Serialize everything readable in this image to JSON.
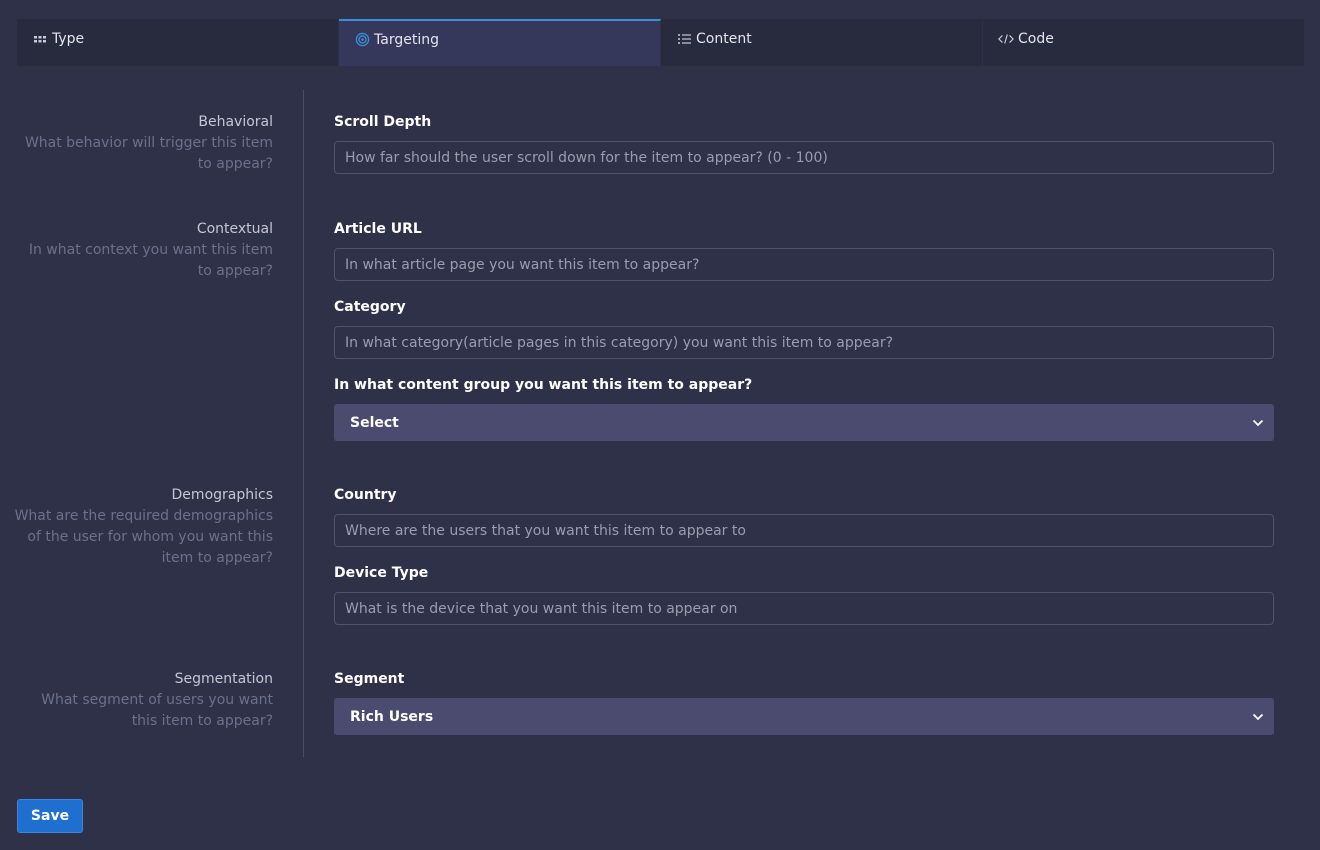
{
  "tabs": [
    {
      "label": "Type",
      "icon": "grid-dots-icon"
    },
    {
      "label": "Targeting",
      "icon": "target-icon"
    },
    {
      "label": "Content",
      "icon": "list-icon"
    },
    {
      "label": "Code",
      "icon": "code-icon"
    }
  ],
  "active_tab": "Targeting",
  "colors": {
    "background": "#2f3149",
    "accent": "#3a8fd6",
    "select_bg": "#4a4b6f",
    "save_button": "#1f6fd1"
  },
  "sections": {
    "behavioral": {
      "title": "Behavioral",
      "description": "What behavior will trigger this item to appear?"
    },
    "contextual": {
      "title": "Contextual",
      "description": "In what context you want this item to appear?"
    },
    "demographics": {
      "title": "Demographics",
      "description": "What are the required demographics of the user for whom you want this item to appear?"
    },
    "segmentation": {
      "title": "Segmentation",
      "description": "What segment of users you want this item to appear?"
    }
  },
  "fields": {
    "scroll_depth": {
      "label": "Scroll Depth",
      "value": "",
      "placeholder": "How far should the user scroll down for the item to appear? (0 - 100)"
    },
    "article_url": {
      "label": "Article URL",
      "value": "",
      "placeholder": "In what article page you want this item to appear?"
    },
    "category": {
      "label": "Category",
      "value": "",
      "placeholder": "In what category(article pages in this category) you want this item to appear?"
    },
    "content_group": {
      "label": "In what content group you want this item to appear?",
      "selected": "Select"
    },
    "country": {
      "label": "Country",
      "value": "",
      "placeholder": "Where are the users that you want this item to appear to"
    },
    "device_type": {
      "label": "Device Type",
      "value": "",
      "placeholder": "What is the device that you want this item to appear on"
    },
    "segment": {
      "label": "Segment",
      "selected": "Rich Users"
    }
  },
  "save_label": "Save"
}
